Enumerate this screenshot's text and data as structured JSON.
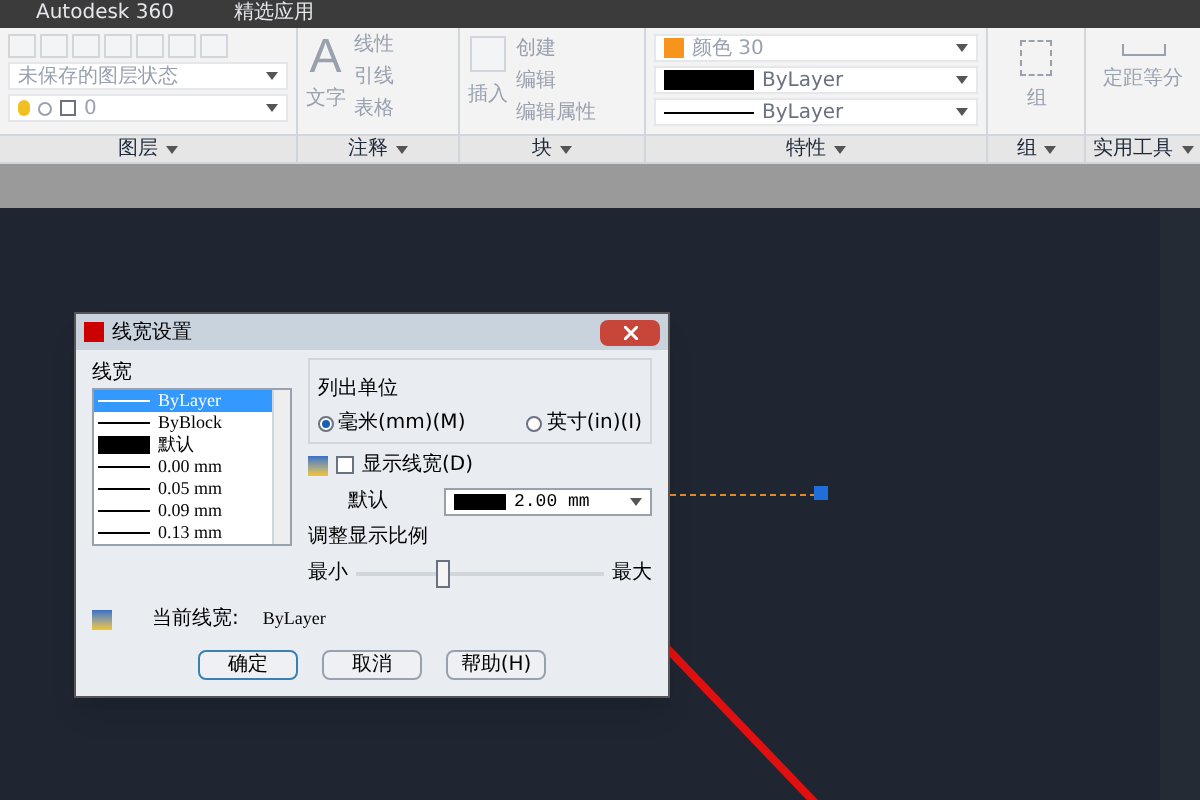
{
  "menu_bar": {
    "items": [
      "Autodesk 360",
      "精选应用"
    ]
  },
  "ribbon": {
    "layers": {
      "state": "未保存的图层状态",
      "layer": "0",
      "title": "图层"
    },
    "annotation": {
      "icon": "A",
      "big": "文字",
      "items": [
        "线性",
        "引线",
        "表格"
      ],
      "title": "注释"
    },
    "block": {
      "big": "插入",
      "items": [
        "创建",
        "编辑",
        "编辑属性"
      ],
      "title": "块"
    },
    "properties": {
      "color_name": "颜色 30",
      "color": "#f7941d",
      "lineweight": "ByLayer",
      "linetype": "ByLayer",
      "title": "特性"
    },
    "group": {
      "big": "组",
      "title": "组"
    },
    "utilities": {
      "big": "定距等分",
      "title": "实用工具"
    }
  },
  "dialog": {
    "title": "线宽设置",
    "list_label": "线宽",
    "items": [
      {
        "label": "ByLayer",
        "kind": "line",
        "selected": true
      },
      {
        "label": "ByBlock",
        "kind": "line",
        "selected": false
      },
      {
        "label": "默认",
        "kind": "swatch",
        "selected": false
      },
      {
        "label": "0.00 mm",
        "kind": "line",
        "selected": false
      },
      {
        "label": "0.05 mm",
        "kind": "line",
        "selected": false
      },
      {
        "label": "0.09 mm",
        "kind": "line",
        "selected": false
      },
      {
        "label": "0.13 mm",
        "kind": "line",
        "selected": false
      }
    ],
    "units_label": "列出单位",
    "units": [
      {
        "label": "毫米(mm)(M)",
        "selected": true
      },
      {
        "label": "英寸(in)(I)",
        "selected": false
      }
    ],
    "show_lineweight": {
      "label": "显示线宽(D)",
      "checked": false
    },
    "default_label": "默认",
    "default_value": "2.00 mm",
    "scale_label": "调整显示比例",
    "scale_min": "最小",
    "scale_max": "最大",
    "scale": {
      "level": 0.35
    },
    "current_label": "当前线宽:",
    "current_value": "ByLayer",
    "buttons": [
      "确定",
      "取消",
      "帮助(H)"
    ]
  }
}
